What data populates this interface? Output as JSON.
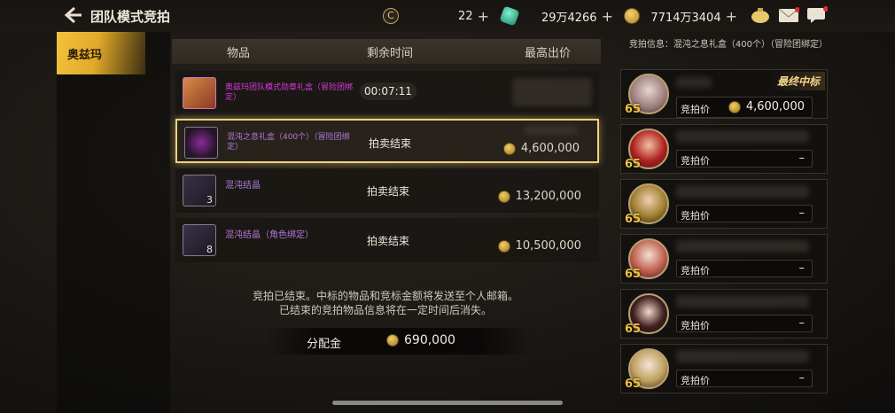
{
  "header": {
    "title": "团队模式竞拍",
    "resources": [
      {
        "icon": "currency-c-icon",
        "value": "22"
      },
      {
        "icon": "gem-icon",
        "value": "29万4266"
      },
      {
        "icon": "gold-coin-icon",
        "value": "7714万3404"
      }
    ]
  },
  "left_tab": {
    "label": "奥兹玛"
  },
  "table": {
    "headers": [
      "物品",
      "剩余时间",
      "最高出价"
    ],
    "rows": [
      {
        "name": "奥兹玛团队模式勋章礼盒（冒险团绑定）",
        "time": "00:07:11",
        "price": "",
        "qty": ""
      },
      {
        "name": "混沌之息礼盒（400个）（冒险团绑定）",
        "time": "拍卖结束",
        "price": "4,600,000",
        "qty": ""
      },
      {
        "name": "混沌结晶",
        "time": "拍卖结束",
        "price": "13,200,000",
        "qty": "3"
      },
      {
        "name": "混沌结晶（角色绑定）",
        "time": "拍卖结束",
        "price": "10,500,000",
        "qty": "8"
      }
    ]
  },
  "notice": {
    "line1": "竞拍已结束。中标的物品和竞标金额将发送至个人邮箱。",
    "line2": "已结束的竞拍物品信息将在一定时间后消失。"
  },
  "distribution": {
    "label": "分配金",
    "value": "690,000"
  },
  "right_panel": {
    "info": "竞拍信息：混沌之息礼盒（400个）（冒险团绑定）",
    "bid_label": "竞拍价",
    "final_badge": "最终中标",
    "bidders": [
      {
        "level": "65",
        "bid": "4,600,000"
      },
      {
        "level": "65",
        "bid": "–"
      },
      {
        "level": "65",
        "bid": "–"
      },
      {
        "level": "65",
        "bid": "–"
      },
      {
        "level": "65",
        "bid": "–"
      },
      {
        "level": "65",
        "bid": "–"
      }
    ]
  },
  "colors": {
    "accent_gold": "#f1d27a",
    "tab_gold": "#f3c23c",
    "pink_item": "#d63ad6",
    "purple_item": "#b07ad8"
  }
}
